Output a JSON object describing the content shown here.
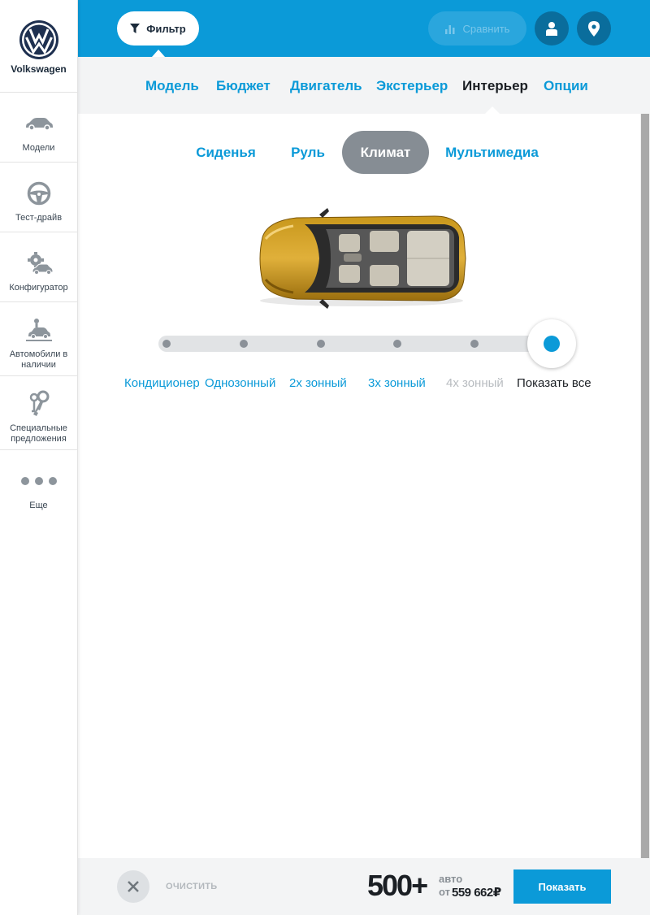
{
  "sidebar": {
    "brand_name": "Volkswagen",
    "items": [
      {
        "label": "Модели",
        "icon": "car-icon"
      },
      {
        "label": "Тест-драйв",
        "icon": "steering-wheel-icon"
      },
      {
        "label": "Конфигуратор",
        "icon": "configurator-icon"
      },
      {
        "label": "Автомобили в наличии",
        "icon": "car-lift-icon"
      },
      {
        "label": "Специальные предложения",
        "icon": "keys-icon"
      },
      {
        "label": "Еще",
        "icon": "more-dots-icon"
      }
    ]
  },
  "topbar": {
    "filter_label": "Фильтр",
    "compare_label": "Сравнить",
    "accent_color": "#0b9ad8"
  },
  "categories": {
    "items": [
      "Модель",
      "Бюджет",
      "Двигатель",
      "Экстерьер",
      "Интерьер",
      "Опции"
    ],
    "active": "Интерьер"
  },
  "subtabs": {
    "items": [
      "Сиденья",
      "Руль",
      "Климат",
      "Мультимедиа"
    ],
    "active": "Климат"
  },
  "climate_slider": {
    "options": [
      "Кондиционер",
      "Однозонный",
      "2х зонный",
      "3х зонный",
      "4х зонный",
      "Показать все"
    ],
    "disabled": [
      "4х зонный"
    ],
    "selected": "Показать все"
  },
  "bottombar": {
    "clear_label": "ОЧИСТИТЬ",
    "count": "500+",
    "count_unit": "авто",
    "price_prefix": "от",
    "price": "559 662₽",
    "show_label": "Показать"
  }
}
